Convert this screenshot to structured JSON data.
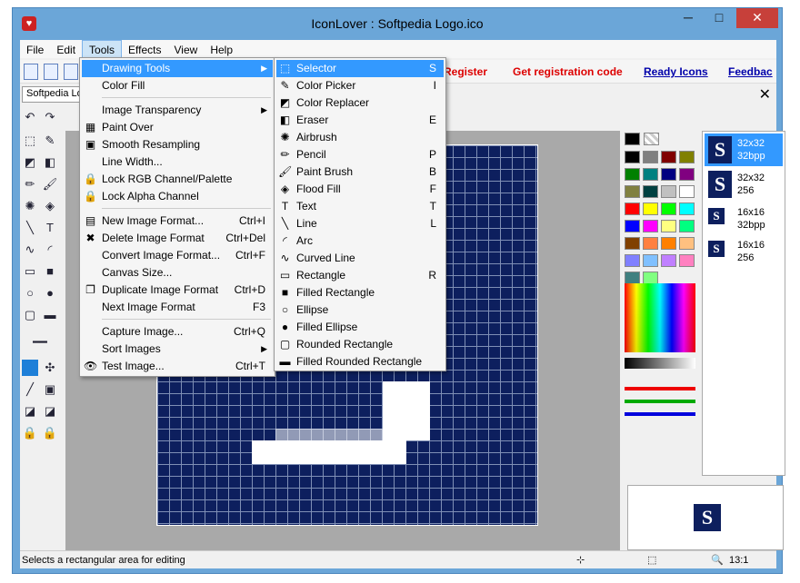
{
  "window": {
    "title": "IconLover : Softpedia Logo.ico",
    "minimize": "─",
    "maximize": "□",
    "close": "✕",
    "app_icon": "♥"
  },
  "menubar": [
    "File",
    "Edit",
    "Tools",
    "Effects",
    "View",
    "Help"
  ],
  "toolbar_links": [
    "Register",
    "Get registration code",
    "Ready Icons",
    "Feedbac"
  ],
  "doc_tab": "Softpedia Lo",
  "tools_menu": [
    {
      "label": "Drawing Tools",
      "shortcut": "",
      "arrow": "▶",
      "icon": ""
    },
    {
      "label": "Color Fill",
      "shortcut": "",
      "arrow": "",
      "icon": ""
    },
    {
      "label": "Image Transparency",
      "shortcut": "",
      "arrow": "▶",
      "icon": ""
    },
    {
      "label": "Paint Over",
      "shortcut": "",
      "arrow": "",
      "icon": "▦"
    },
    {
      "label": "Smooth Resampling",
      "shortcut": "",
      "arrow": "",
      "icon": "▣"
    },
    {
      "label": "Line Width...",
      "shortcut": "",
      "arrow": "",
      "icon": ""
    },
    {
      "label": "Lock RGB Channel/Palette",
      "shortcut": "",
      "arrow": "",
      "icon": "🔒"
    },
    {
      "label": "Lock Alpha Channel",
      "shortcut": "",
      "arrow": "",
      "icon": "🔒"
    },
    {
      "label": "New Image Format...",
      "shortcut": "Ctrl+I",
      "arrow": "",
      "icon": "▤"
    },
    {
      "label": "Delete Image Format",
      "shortcut": "Ctrl+Del",
      "arrow": "",
      "icon": "✖"
    },
    {
      "label": "Convert Image Format...",
      "shortcut": "Ctrl+F",
      "arrow": "",
      "icon": ""
    },
    {
      "label": "Canvas Size...",
      "shortcut": "",
      "arrow": "",
      "icon": ""
    },
    {
      "label": "Duplicate Image Format",
      "shortcut": "Ctrl+D",
      "arrow": "",
      "icon": "❐"
    },
    {
      "label": "Next Image Format",
      "shortcut": "F3",
      "arrow": "",
      "icon": ""
    },
    {
      "label": "Capture Image...",
      "shortcut": "Ctrl+Q",
      "arrow": "",
      "icon": ""
    },
    {
      "label": "Sort Images",
      "shortcut": "",
      "arrow": "▶",
      "icon": ""
    },
    {
      "label": "Test Image...",
      "shortcut": "Ctrl+T",
      "arrow": "",
      "icon": "👁"
    }
  ],
  "drawing_tools_menu": [
    {
      "label": "Selector",
      "shortcut": "S",
      "icon": "⬚"
    },
    {
      "label": "Color Picker",
      "shortcut": "I",
      "icon": "✎"
    },
    {
      "label": "Color Replacer",
      "shortcut": "",
      "icon": "◩"
    },
    {
      "label": "Eraser",
      "shortcut": "E",
      "icon": "◧"
    },
    {
      "label": "Airbrush",
      "shortcut": "",
      "icon": "✺"
    },
    {
      "label": "Pencil",
      "shortcut": "P",
      "icon": "✏"
    },
    {
      "label": "Paint Brush",
      "shortcut": "B",
      "icon": "🖌"
    },
    {
      "label": "Flood Fill",
      "shortcut": "F",
      "icon": "◈"
    },
    {
      "label": "Text",
      "shortcut": "T",
      "icon": "T"
    },
    {
      "label": "Line",
      "shortcut": "L",
      "icon": "╲"
    },
    {
      "label": "Arc",
      "shortcut": "",
      "icon": "◜"
    },
    {
      "label": "Curved Line",
      "shortcut": "",
      "icon": "∿"
    },
    {
      "label": "Rectangle",
      "shortcut": "R",
      "icon": "▭"
    },
    {
      "label": "Filled Rectangle",
      "shortcut": "",
      "icon": "■"
    },
    {
      "label": "Ellipse",
      "shortcut": "",
      "icon": "○"
    },
    {
      "label": "Filled Ellipse",
      "shortcut": "",
      "icon": "●"
    },
    {
      "label": "Rounded Rectangle",
      "shortcut": "",
      "icon": "▢"
    },
    {
      "label": "Filled Rounded Rectangle",
      "shortcut": "",
      "icon": "▬"
    }
  ],
  "image_formats": [
    {
      "size": "32x32",
      "depth": "32bpp",
      "glyph": "S"
    },
    {
      "size": "32x32",
      "depth": "256",
      "glyph": "S"
    },
    {
      "size": "16x16",
      "depth": "32bpp",
      "glyph": "S"
    },
    {
      "size": "16x16",
      "depth": "256",
      "glyph": "S"
    }
  ],
  "preview_glyph": "S",
  "palette_colors": [
    "#000000",
    "#808080",
    "#800000",
    "#808000",
    "#008000",
    "#008080",
    "#000080",
    "#800080",
    "#808040",
    "#004040",
    "#c0c0c0",
    "#ffffff",
    "#ff0000",
    "#ffff00",
    "#00ff00",
    "#00ffff",
    "#0000ff",
    "#ff00ff",
    "#ffff80",
    "#00ff80",
    "#804000",
    "#ff8040",
    "#ff8000",
    "#ffc080",
    "#8080ff",
    "#80c0ff",
    "#c080ff",
    "#ff80c0",
    "#408080",
    "#80ff80"
  ],
  "status": {
    "hint": "Selects a rectangular area for editing",
    "zoom": "13:1"
  }
}
